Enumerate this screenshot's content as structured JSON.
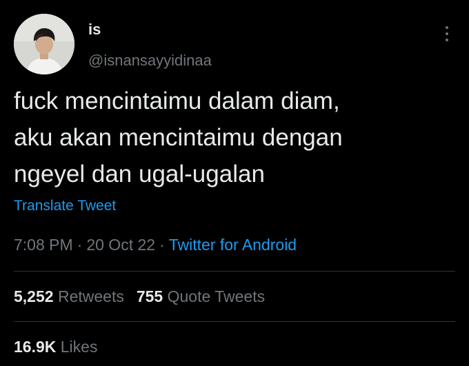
{
  "user": {
    "display_name": "is",
    "handle": "@isnansayyidinaa",
    "avatar_icon": "profile-photo"
  },
  "tweet": {
    "text": "fuck mencintaimu dalam diam,\naku akan mencintaimu dengan\nngeyel dan ugal-ugalan",
    "translate_label": "Translate Tweet",
    "time": "7:08 PM",
    "date": "20 Oct 22",
    "separator": "·",
    "source": "Twitter for Android"
  },
  "stats": {
    "retweets_count": "5,252",
    "retweets_label": "Retweets",
    "quotes_count": "755",
    "quotes_label": "Quote Tweets",
    "likes_count": "16.9K",
    "likes_label": "Likes"
  },
  "colors": {
    "background": "#000000",
    "text_primary": "#e7e9ea",
    "text_secondary": "#71767b",
    "accent": "#1d9bf0",
    "divider": "#2f3336"
  },
  "icons": {
    "more": "more-vertical-icon"
  }
}
